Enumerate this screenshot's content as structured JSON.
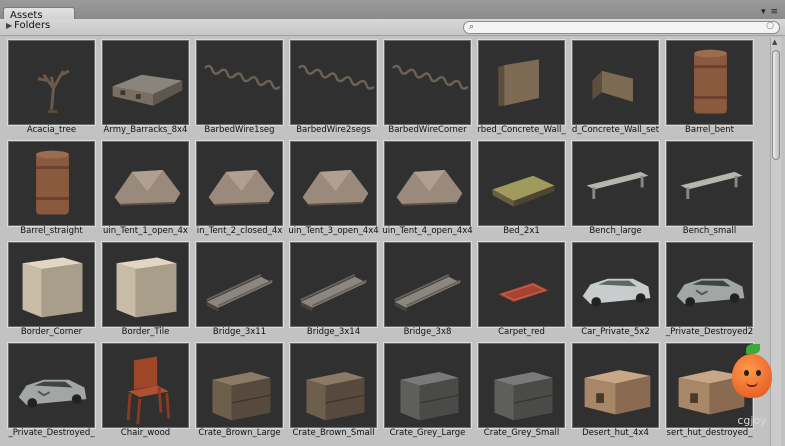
{
  "window": {
    "tab_label": "Assets",
    "controls": "▾ ≡"
  },
  "toolbar": {
    "folders_label": "Folders",
    "search_placeholder": ""
  },
  "assets": [
    {
      "label": "Acacia_tree",
      "icon": "tree-icon"
    },
    {
      "label": "Army_Barracks_8x4",
      "icon": "barracks-icon"
    },
    {
      "label": "BarbedWire1seg",
      "icon": "barbed-wire-icon"
    },
    {
      "label": "BarbedWire2segs",
      "icon": "barbed-wire-icon"
    },
    {
      "label": "BarbedWireCorner",
      "icon": "barbed-wire-icon"
    },
    {
      "label": "rbed_Concrete_Wall_",
      "icon": "concrete-wall-icon"
    },
    {
      "label": "d_Concrete_Wall_set",
      "icon": "concrete-wall-set-icon"
    },
    {
      "label": "Barrel_bent",
      "icon": "barrel-icon"
    },
    {
      "label": "Barrel_straight",
      "icon": "barrel-icon"
    },
    {
      "label": "uin_Tent_1_open_4x",
      "icon": "tent-icon"
    },
    {
      "label": "in_Tent_2_closed_4x",
      "icon": "tent-icon"
    },
    {
      "label": "uin_Tent_3_open_4x4",
      "icon": "tent-icon"
    },
    {
      "label": "uin_Tent_4_open_4x4",
      "icon": "tent-icon"
    },
    {
      "label": "Bed_2x1",
      "icon": "bed-icon"
    },
    {
      "label": "Bench_large",
      "icon": "bench-icon"
    },
    {
      "label": "Bench_small",
      "icon": "bench-icon"
    },
    {
      "label": "Border_Corner",
      "icon": "border-block-icon"
    },
    {
      "label": "Border_Tile",
      "icon": "border-block-icon"
    },
    {
      "label": "Bridge_3x11",
      "icon": "bridge-icon"
    },
    {
      "label": "Bridge_3x14",
      "icon": "bridge-icon"
    },
    {
      "label": "Bridge_3x8",
      "icon": "bridge-icon"
    },
    {
      "label": "Carpet_red",
      "icon": "carpet-icon"
    },
    {
      "label": "Car_Private_5x2",
      "icon": "car-icon"
    },
    {
      "label": "_Private_Destroyed2",
      "icon": "car-destroyed-icon"
    },
    {
      "label": "_Private_Destroyed_",
      "icon": "car-destroyed-icon"
    },
    {
      "label": "Chair_wood",
      "icon": "chair-icon"
    },
    {
      "label": "Crate_Brown_Large",
      "icon": "crate-icon"
    },
    {
      "label": "Crate_Brown_Small",
      "icon": "crate-icon"
    },
    {
      "label": "Crate_Grey_Large",
      "icon": "crate-icon"
    },
    {
      "label": "Crate_Grey_Small",
      "icon": "crate-icon"
    },
    {
      "label": "Desert_hut_4x4",
      "icon": "hut-icon"
    },
    {
      "label": "sert_hut_destroyed_",
      "icon": "hut-icon"
    }
  ],
  "watermark": {
    "text": "cgjoy",
    "icon": "mascot-icon"
  }
}
